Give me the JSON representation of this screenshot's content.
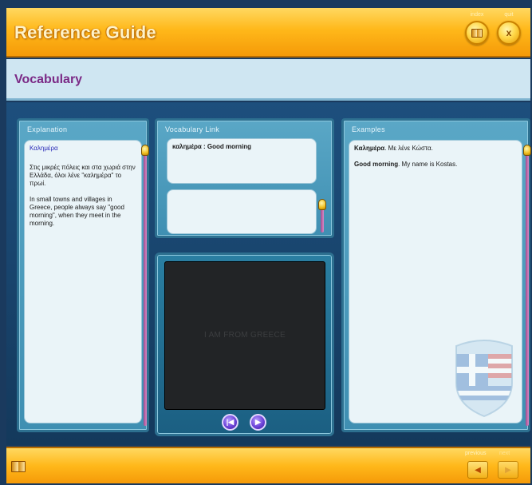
{
  "header": {
    "title": "Reference Guide",
    "index_label": "index",
    "quit_label": "quit",
    "quit_glyph": "x"
  },
  "section": {
    "title": "Vocabulary"
  },
  "explanation": {
    "title": "Explanation",
    "term": "Καλημέρα",
    "paragraph_greek": "Στις μικρές πόλεις και στα χωριά στην Ελλάδα, όλοι λένε \"καλημέρα\" το πρωί.",
    "paragraph_english": "In small towns and villages in Greece, people always say \"good morning\", when they meet in the morning."
  },
  "vocabulary_link": {
    "title": "Vocabulary Link",
    "entry": "καλημέρα : Good morning",
    "second_entry": ""
  },
  "video": {
    "caption": "I AM FROM GREECE",
    "rewind_glyph": "|◀",
    "play_glyph": "▶"
  },
  "examples": {
    "title": "Examples",
    "line1_bold": "Καλημέρα",
    "line1_rest": ". Με λένε Κώστα.",
    "line2_bold": "Good morning",
    "line2_rest": ". My name is Kostas."
  },
  "footer": {
    "previous_label": "previous",
    "next_label": "next",
    "previous_glyph": "◀",
    "next_glyph": "▶"
  },
  "colors": {
    "orange_bar": "#ffb81a",
    "section_bg": "#cfe6f2",
    "section_title": "#7b2a86",
    "panel_blue": "#4a99bc",
    "dark_navy": "#1a3a5e",
    "video_button": "#6d43d8"
  },
  "icons": {
    "index": "book-icon",
    "quit": "close-icon",
    "footer_left": "book-icon",
    "previous": "triangle-left-icon",
    "next": "triangle-right-icon",
    "rewind": "skip-back-icon",
    "play": "play-icon"
  }
}
